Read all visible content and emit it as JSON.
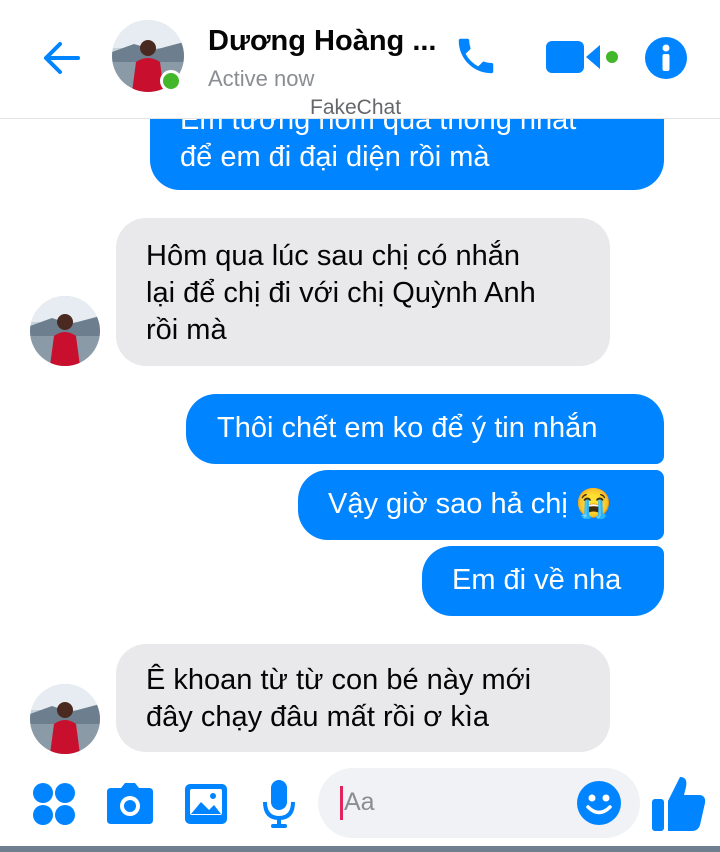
{
  "header": {
    "contact_name": "Dương Hoàng ...",
    "status": "Active now",
    "watermark": "FakeChat"
  },
  "messages": [
    {
      "direction": "outgoing",
      "lines": [
        "Em tưởng hôm qua thống nhất",
        "để em đi đại diện rồi mà"
      ]
    },
    {
      "direction": "incoming",
      "lines": [
        "Hôm qua lúc sau chị có nhắn",
        "lại để chị đi với chị Quỳnh Anh",
        "rồi mà"
      ]
    },
    {
      "direction": "outgoing",
      "lines": [
        "Thôi chết em ko để ý tin nhắn"
      ]
    },
    {
      "direction": "outgoing",
      "lines": [
        "Vậy giờ sao hả chị 😭"
      ]
    },
    {
      "direction": "outgoing",
      "lines": [
        "Em đi về nha"
      ]
    },
    {
      "direction": "incoming",
      "lines": [
        "Ê khoan từ từ con bé này mới",
        "đây chạy đâu mất rồi ơ kìa"
      ]
    }
  ],
  "composer": {
    "placeholder": "Aa"
  },
  "colors": {
    "accent": "#0084ff",
    "incoming_bubble": "#e9e9eb",
    "presence": "#42b72a"
  },
  "icons": [
    "back-arrow-icon",
    "phone-icon",
    "video-call-icon",
    "info-icon",
    "apps-grid-icon",
    "camera-icon",
    "gallery-icon",
    "microphone-icon",
    "emoji-icon",
    "thumbs-up-icon"
  ]
}
